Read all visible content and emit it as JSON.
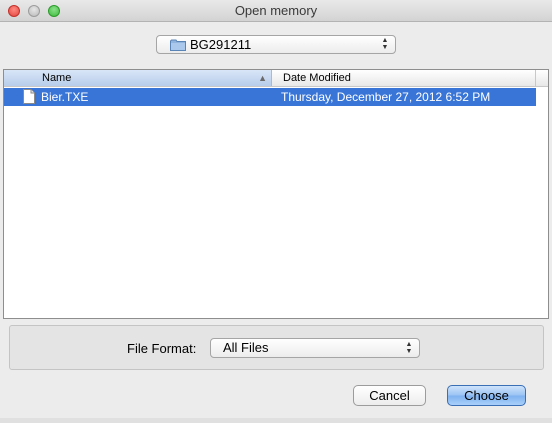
{
  "window": {
    "title": "Open memory",
    "controls": [
      "close",
      "minimize",
      "zoom"
    ]
  },
  "location": {
    "selected": "BG291211",
    "icon": "folder-icon"
  },
  "file_list": {
    "columns": [
      "Name",
      "Date Modified"
    ],
    "sort_column": "Name",
    "rows": [
      {
        "name": "Bier.TXE",
        "date_modified": "Thursday, December 27, 2012 6:52 PM",
        "icon": "document-icon",
        "selected": true
      }
    ],
    "selection_color": "#3875d7"
  },
  "format": {
    "label": "File Format:",
    "selected": "All Files"
  },
  "buttons": {
    "cancel": "Cancel",
    "choose": "Choose"
  }
}
